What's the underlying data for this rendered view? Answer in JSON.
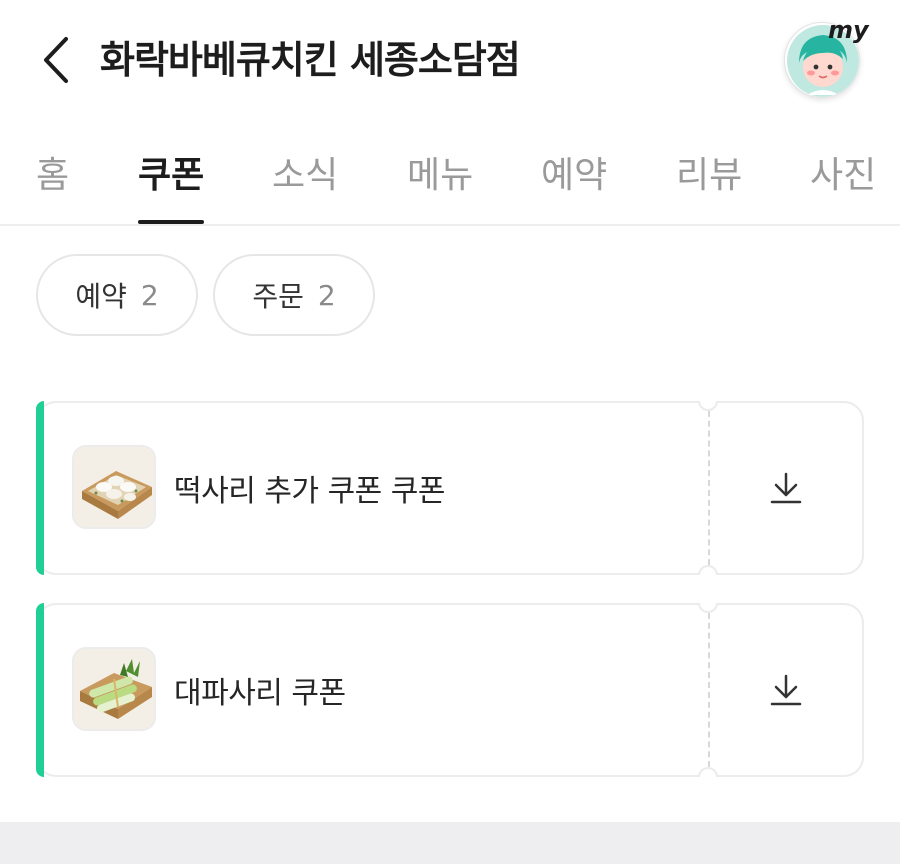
{
  "header": {
    "title": "화락바베큐치킨 세종소담점",
    "my_label": "my",
    "back_icon": "chevron-left-icon"
  },
  "tabs": [
    {
      "label": "홈",
      "active": false
    },
    {
      "label": "쿠폰",
      "active": true
    },
    {
      "label": "소식",
      "active": false
    },
    {
      "label": "메뉴",
      "active": false
    },
    {
      "label": "예약",
      "active": false
    },
    {
      "label": "리뷰",
      "active": false
    },
    {
      "label": "사진",
      "active": false
    }
  ],
  "filters": [
    {
      "label": "예약",
      "count": "2"
    },
    {
      "label": "주문",
      "count": "2"
    }
  ],
  "coupons": [
    {
      "name": "떡사리 추가 쿠폰 쿠폰",
      "thumb": "rice-cake-dish",
      "action_icon": "download-icon"
    },
    {
      "name": "대파사리 쿠폰",
      "thumb": "green-onion-dish",
      "action_icon": "download-icon"
    }
  ],
  "colors": {
    "accent": "#1fcf95",
    "text_primary": "#1d1d1d",
    "text_muted": "#9a9a9a",
    "border": "#ececec",
    "band": "#eeeef0"
  }
}
